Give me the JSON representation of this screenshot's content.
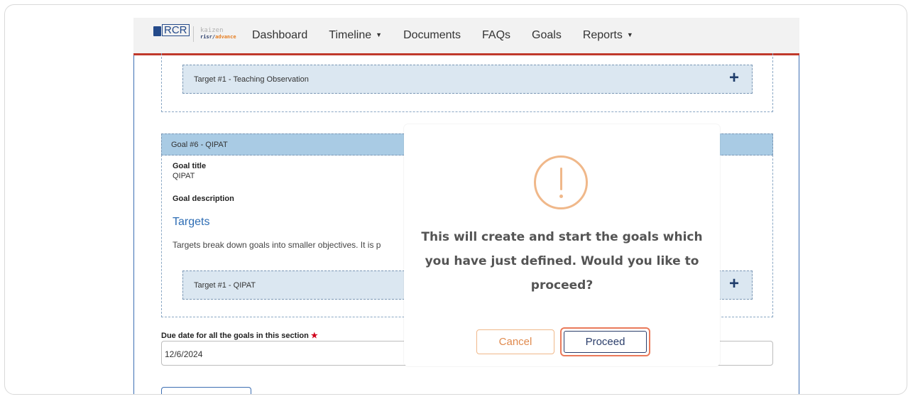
{
  "nav": {
    "logo_rcr": "RCR",
    "logo_kaizen_top": "kaizen",
    "logo_kaizen_bottom": "risr/",
    "logo_kaizen_advance": "advance",
    "items": [
      {
        "label": "Dashboard",
        "has_caret": false
      },
      {
        "label": "Timeline",
        "has_caret": true
      },
      {
        "label": "Documents",
        "has_caret": false
      },
      {
        "label": "FAQs",
        "has_caret": false
      },
      {
        "label": "Goals",
        "has_caret": false
      },
      {
        "label": "Reports",
        "has_caret": true
      }
    ]
  },
  "content": {
    "target_top_label": "Target #1 - Teaching Observation",
    "goal_header": "Goal #6 - QIPAT",
    "goal_title_label": "Goal title",
    "goal_title_value": "QIPAT",
    "goal_description_label": "Goal description",
    "targets_heading": "Targets",
    "targets_description": "Targets break down goals into smaller objectives. It is p",
    "target_bottom_label": "Target #1 - QIPAT",
    "due_date_label": "Due date for all the goals in this section",
    "due_date_value": "12/6/2024"
  },
  "modal": {
    "message": "This will create and start the goals which you have just defined. Would you like to proceed?",
    "cancel_label": "Cancel",
    "proceed_label": "Proceed"
  },
  "colors": {
    "accent_red": "#c0392b",
    "panel_blue": "#dbe7f1",
    "header_blue": "#a9cbe4",
    "link_blue": "#2e6db4",
    "warning_orange": "#f0b88a",
    "proceed_highlight": "#ea7a5a"
  }
}
